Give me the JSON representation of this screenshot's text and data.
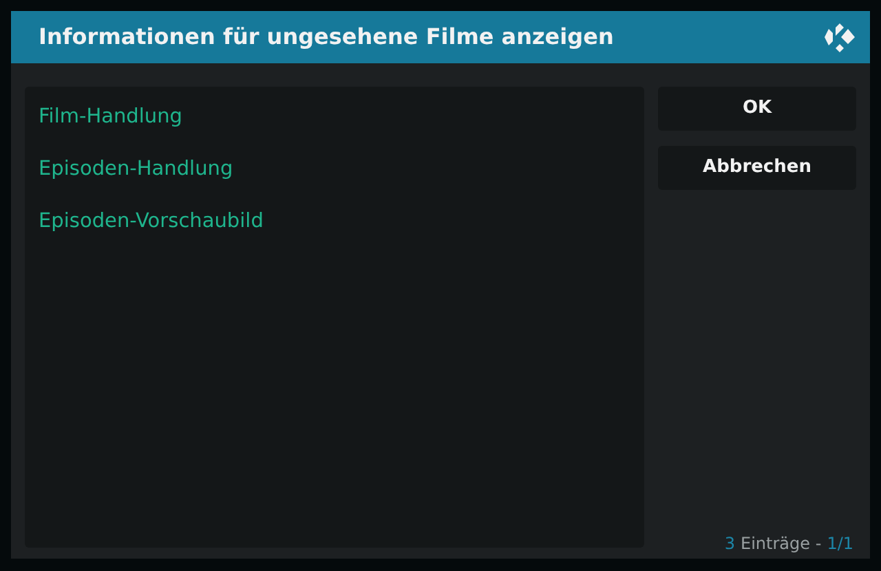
{
  "dialog": {
    "title": "Informationen für ungesehene Filme anzeigen"
  },
  "items": [
    {
      "label": "Film-Handlung"
    },
    {
      "label": "Episoden-Handlung"
    },
    {
      "label": "Episoden-Vorschaubild"
    }
  ],
  "buttons": [
    {
      "label": "OK"
    },
    {
      "label": "Abbrechen"
    }
  ],
  "footer": {
    "count": "3",
    "label": "Einträge -",
    "page": "1/1"
  }
}
